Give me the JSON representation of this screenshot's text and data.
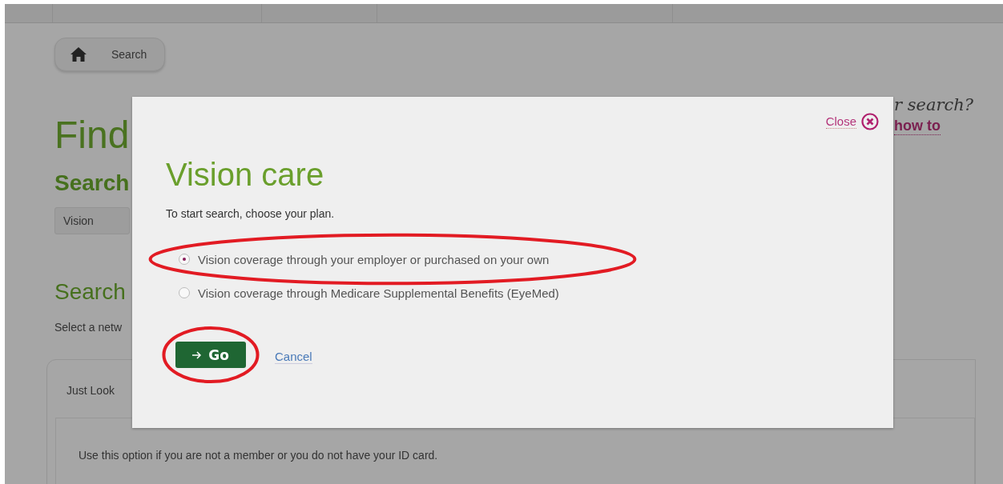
{
  "breadcrumb": {
    "items": [
      "Search"
    ]
  },
  "page": {
    "title": "Find",
    "heading_1": "Search",
    "plan_dropdown": {
      "value": "Vision"
    },
    "heading_2": "Search",
    "intro_text": "Select a netw",
    "card": {
      "tab_label": "Just Look",
      "description": "Use this option if you are not a member or you do not have your ID card."
    }
  },
  "help": {
    "question": "r search?",
    "link": "how to"
  },
  "dialog": {
    "close_label": "Close",
    "title": "Vision care",
    "instruction": "To start search, choose your plan.",
    "options": [
      {
        "label": "Vision coverage through your employer or purchased on your own",
        "selected": true,
        "highlighted": true
      },
      {
        "label": "Vision coverage through Medicare Supplemental Benefits (EyeMed)",
        "selected": false,
        "highlighted": false
      }
    ],
    "go_button": {
      "label": "Go",
      "highlighted": true
    },
    "cancel_link": "Cancel"
  }
}
